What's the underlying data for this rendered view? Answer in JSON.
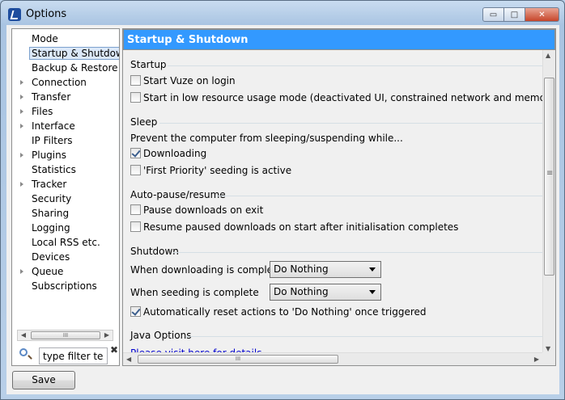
{
  "window": {
    "title": "Options",
    "minimize_glyph": "▭",
    "maximize_glyph": "□",
    "close_glyph": "✕"
  },
  "tree": {
    "items": [
      {
        "label": "Mode",
        "expandable": false,
        "selected": false
      },
      {
        "label": "Startup & Shutdown",
        "expandable": false,
        "selected": true
      },
      {
        "label": "Backup & Restore",
        "expandable": false,
        "selected": false
      },
      {
        "label": "Connection",
        "expandable": true,
        "selected": false
      },
      {
        "label": "Transfer",
        "expandable": true,
        "selected": false
      },
      {
        "label": "Files",
        "expandable": true,
        "selected": false
      },
      {
        "label": "Interface",
        "expandable": true,
        "selected": false
      },
      {
        "label": "IP Filters",
        "expandable": false,
        "selected": false
      },
      {
        "label": "Plugins",
        "expandable": true,
        "selected": false
      },
      {
        "label": "Statistics",
        "expandable": false,
        "selected": false
      },
      {
        "label": "Tracker",
        "expandable": true,
        "selected": false
      },
      {
        "label": "Security",
        "expandable": false,
        "selected": false
      },
      {
        "label": "Sharing",
        "expandable": false,
        "selected": false
      },
      {
        "label": "Logging",
        "expandable": false,
        "selected": false
      },
      {
        "label": "Local RSS etc.",
        "expandable": false,
        "selected": false
      },
      {
        "label": "Devices",
        "expandable": false,
        "selected": false
      },
      {
        "label": "Queue",
        "expandable": true,
        "selected": false
      },
      {
        "label": "Subscriptions",
        "expandable": false,
        "selected": false
      }
    ],
    "filter_value": "type filter text",
    "clear_glyph": "✖"
  },
  "panel": {
    "header": "Startup & Shutdown",
    "startup": {
      "title": "Startup",
      "start_on_login": {
        "label": "Start Vuze on login",
        "checked": false
      },
      "low_resource": {
        "label": "Start in low resource usage mode (deactivated UI, constrained network and memory usage etc",
        "checked": false
      }
    },
    "sleep": {
      "title": "Sleep",
      "description": "Prevent the computer from sleeping/suspending while...",
      "downloading": {
        "label": "Downloading",
        "checked": true
      },
      "first_priority": {
        "label": "'First Priority' seeding is active",
        "checked": false
      }
    },
    "autopause": {
      "title": "Auto-pause/resume",
      "pause_on_exit": {
        "label": "Pause downloads on exit",
        "checked": false
      },
      "resume_paused": {
        "label": "Resume paused downloads on start after initialisation completes",
        "checked": false
      }
    },
    "shutdown": {
      "title": "Shutdown",
      "downloading_label": "When downloading is complete",
      "downloading_value": "Do Nothing",
      "seeding_label": "When seeding is complete",
      "seeding_value": "Do Nothing",
      "auto_reset": {
        "label": "Automatically reset actions to 'Do Nothing' once triggered",
        "checked": true
      }
    },
    "java": {
      "title": "Java Options",
      "link": "Please visit here for details"
    }
  },
  "scroll": {
    "grip": "III",
    "left_arrow": "◀",
    "right_arrow": "▶",
    "up_arrow": "▲",
    "down_arrow": "▼"
  },
  "buttons": {
    "save": "Save"
  }
}
